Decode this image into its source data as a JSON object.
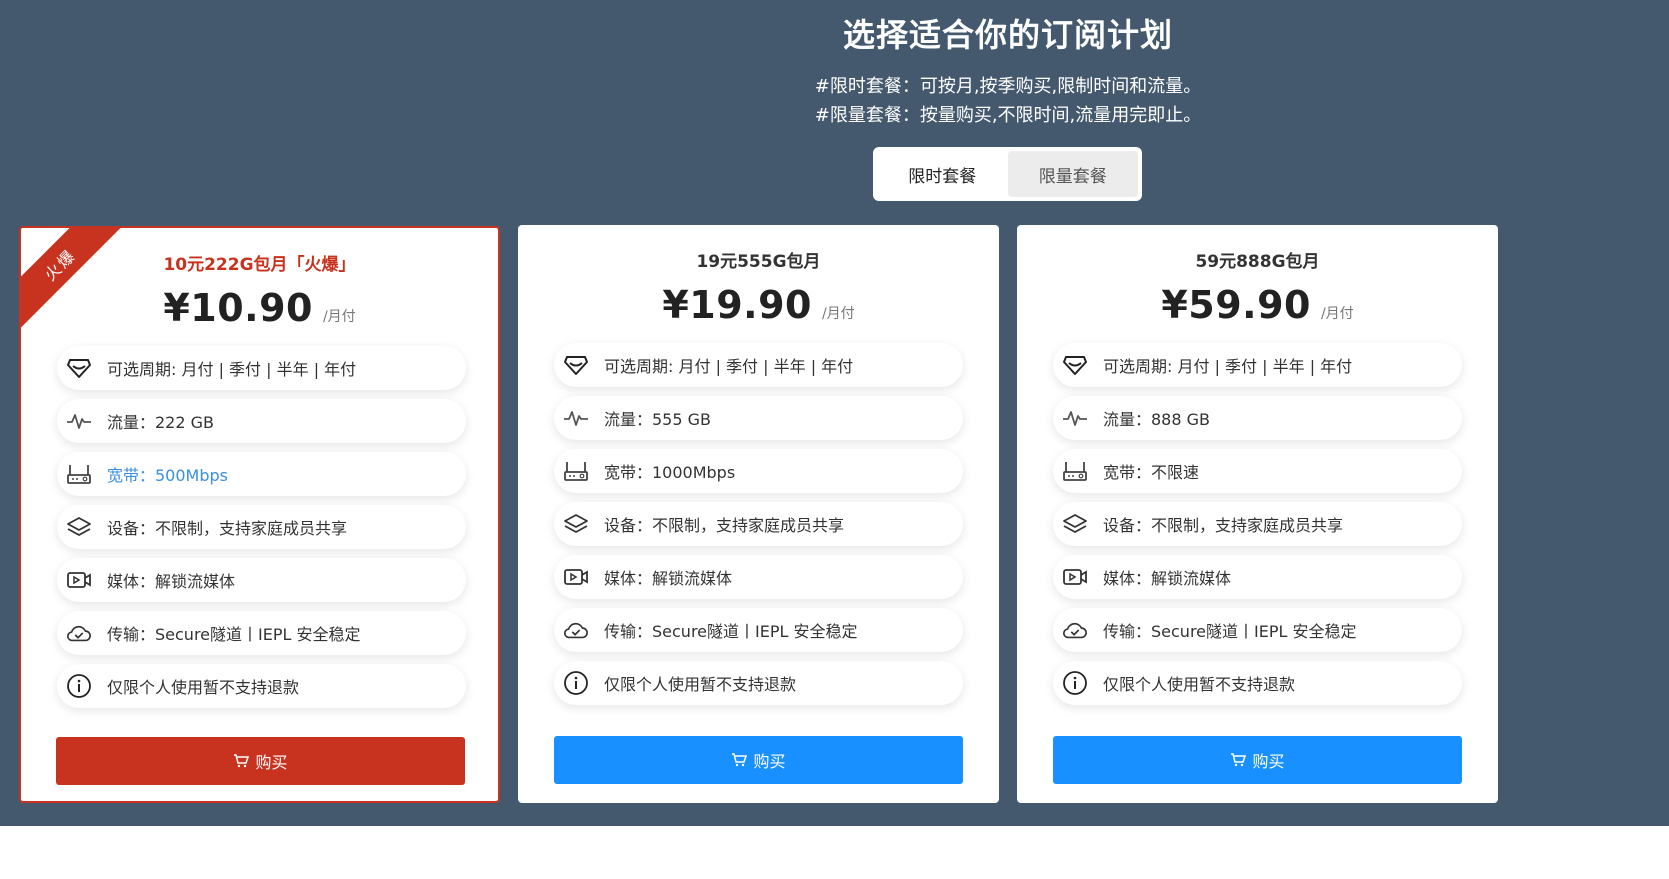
{
  "header": {
    "title": "选择适合你的订阅计划",
    "desc_lines": [
      "#限时套餐：可按月,按季购买,限制时间和流量。",
      "#限量套餐：按量购买,不限时间,流量用完即止。"
    ],
    "tabs": [
      {
        "label": "限时套餐",
        "active": true
      },
      {
        "label": "限量套餐",
        "active": false
      }
    ]
  },
  "colors": {
    "hot": "#c8331f",
    "primary": "#1890ff",
    "background": "#44596e",
    "bandwidth_highlight": "#3a8fe0"
  },
  "plans": [
    {
      "ribbon": "火爆",
      "name": "10元222G包月「火爆」",
      "price": "¥10.90",
      "period": "/月付",
      "features": [
        {
          "icon": "diamond-icon",
          "text": "可选周期: 月付 | 季付 | 半年 | 年付"
        },
        {
          "icon": "pulse-icon",
          "text": "流量：222 GB"
        },
        {
          "icon": "router-icon",
          "text": "宽带：500Mbps"
        },
        {
          "icon": "layers-icon",
          "text": "设备：不限制，支持家庭成员共享"
        },
        {
          "icon": "video-icon",
          "text": "媒体：解锁流媒体"
        },
        {
          "icon": "cloud-check-icon",
          "text": "传输：Secure隧道丨IEPL 安全稳定"
        },
        {
          "icon": "info-icon",
          "text": "仅限个人使用暂不支持退款"
        }
      ],
      "buy_label": "购买"
    },
    {
      "name": "19元555G包月",
      "price": "¥19.90",
      "period": "/月付",
      "features": [
        {
          "icon": "diamond-icon",
          "text": "可选周期: 月付 | 季付 | 半年 | 年付"
        },
        {
          "icon": "pulse-icon",
          "text": "流量：555 GB"
        },
        {
          "icon": "router-icon",
          "text": "宽带：1000Mbps"
        },
        {
          "icon": "layers-icon",
          "text": "设备：不限制，支持家庭成员共享"
        },
        {
          "icon": "video-icon",
          "text": "媒体：解锁流媒体"
        },
        {
          "icon": "cloud-check-icon",
          "text": "传输：Secure隧道丨IEPL 安全稳定"
        },
        {
          "icon": "info-icon",
          "text": "仅限个人使用暂不支持退款"
        }
      ],
      "buy_label": "购买"
    },
    {
      "name": "59元888G包月",
      "price": "¥59.90",
      "period": "/月付",
      "features": [
        {
          "icon": "diamond-icon",
          "text": "可选周期: 月付 | 季付 | 半年 | 年付"
        },
        {
          "icon": "pulse-icon",
          "text": "流量：888 GB"
        },
        {
          "icon": "router-icon",
          "text": "宽带：不限速"
        },
        {
          "icon": "layers-icon",
          "text": "设备：不限制，支持家庭成员共享"
        },
        {
          "icon": "video-icon",
          "text": "媒体：解锁流媒体"
        },
        {
          "icon": "cloud-check-icon",
          "text": "传输：Secure隧道丨IEPL 安全稳定"
        },
        {
          "icon": "info-icon",
          "text": "仅限个人使用暂不支持退款"
        }
      ],
      "buy_label": "购买"
    }
  ]
}
